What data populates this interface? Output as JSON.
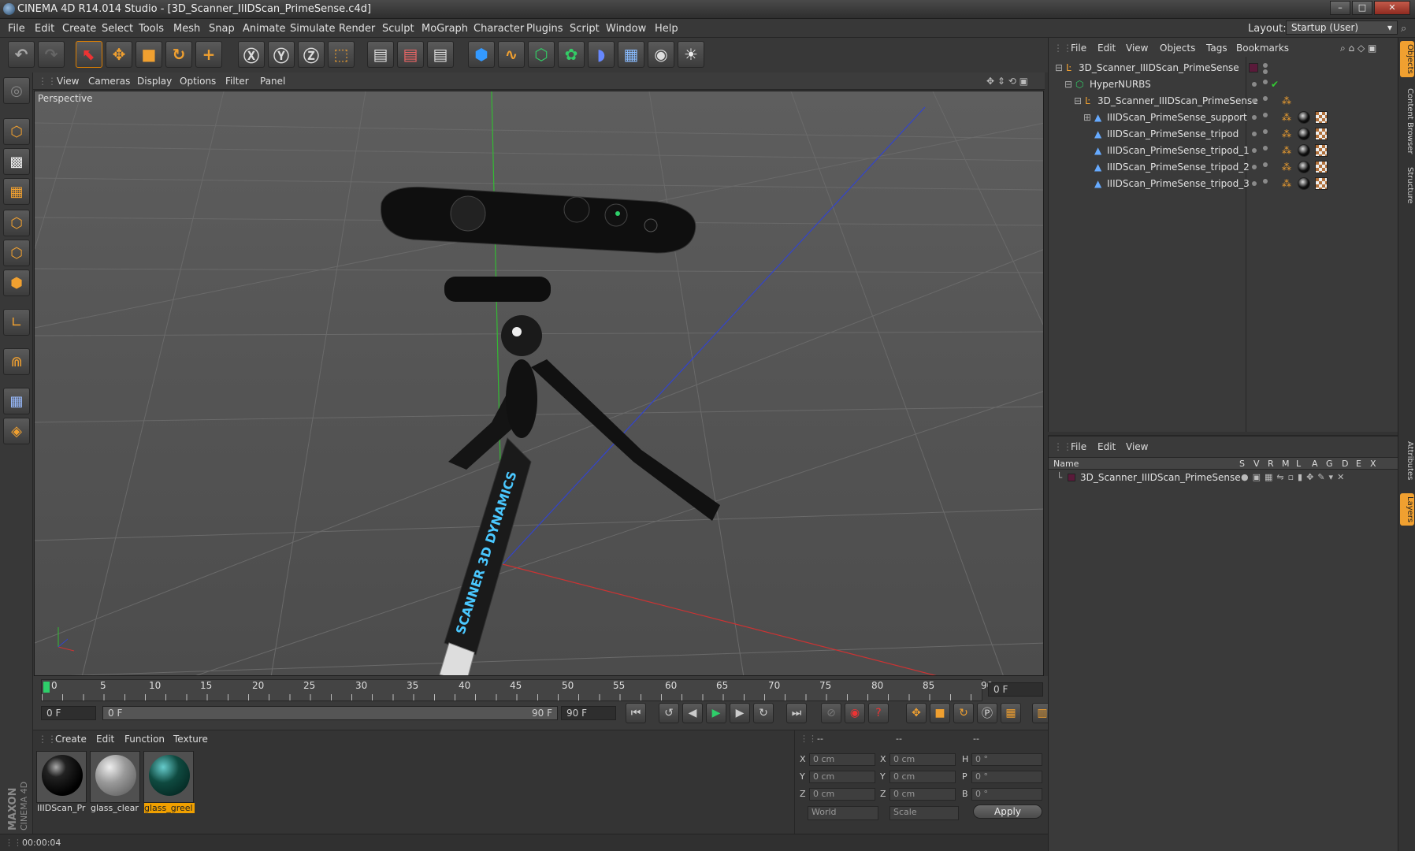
{
  "window": {
    "title": "CINEMA 4D R14.014 Studio - [3D_Scanner_IIIDScan_PrimeSense.c4d]",
    "min": "–",
    "max": "□",
    "close": "✕"
  },
  "menu": [
    "File",
    "Edit",
    "Create",
    "Select",
    "Tools",
    "Mesh",
    "Snap",
    "Animate",
    "Simulate",
    "Render",
    "Sculpt",
    "MoGraph",
    "Character",
    "Plugins",
    "Script",
    "Window",
    "Help"
  ],
  "layout": {
    "label": "Layout:",
    "value": "Startup (User)"
  },
  "toolbar": {
    "icons": [
      "undo-icon",
      "redo-icon",
      "select-icon",
      "move-icon",
      "scale-icon",
      "rotate-icon",
      "add-icon",
      "x-axis-icon",
      "y-axis-icon",
      "z-axis-icon",
      "coordinate-system-icon",
      "render-view-icon",
      "render-picture-queue-icon",
      "render-settings-icon",
      "cube-icon",
      "spline-icon",
      "nurbs-icon",
      "array-icon",
      "deformer-icon",
      "floor-icon",
      "camera-icon",
      "light-icon"
    ]
  },
  "left_tools": [
    "model-mode-icon",
    "texture-mode-icon",
    "workplane-icon",
    "point-mode-icon",
    "edge-mode-icon",
    "polygon-mode-icon",
    "axis-icon",
    "magnet-icon",
    "snap-icon",
    "locked-workplane-icon"
  ],
  "viewport": {
    "menu": [
      "View",
      "Cameras",
      "Display",
      "Options",
      "Filter",
      "Panel"
    ],
    "label": "Perspective",
    "brand_text": "SCANNER 3D DYNAMICS"
  },
  "timeline": {
    "ticks": [
      "0",
      "5",
      "10",
      "15",
      "20",
      "25",
      "30",
      "35",
      "40",
      "45",
      "50",
      "55",
      "60",
      "65",
      "70",
      "75",
      "80",
      "85",
      "90"
    ],
    "current": "0 F",
    "start": "0 F",
    "range_start": "0 F",
    "range_end": "90 F",
    "end": "90 F"
  },
  "materials": {
    "menu": [
      "Create",
      "Edit",
      "Function",
      "Texture"
    ],
    "items": [
      {
        "name": "IIIDScan_Pr",
        "color": "#111111"
      },
      {
        "name": "glass_clear",
        "color": "#9a9a9a"
      },
      {
        "name": "glass_greel",
        "color": "#0f4a40",
        "selected": true
      }
    ]
  },
  "coords": {
    "headers": [
      "--",
      "--",
      "--"
    ],
    "rows": [
      {
        "a": "X",
        "av": "0 cm",
        "b": "X",
        "bv": "0 cm",
        "c": "H",
        "cv": "0 °"
      },
      {
        "a": "Y",
        "av": "0 cm",
        "b": "Y",
        "bv": "0 cm",
        "c": "P",
        "cv": "0 °"
      },
      {
        "a": "Z",
        "av": "0 cm",
        "b": "Z",
        "bv": "0 cm",
        "c": "B",
        "cv": "0 °"
      }
    ],
    "mode1": "World",
    "mode2": "Scale",
    "apply": "Apply"
  },
  "status": {
    "time": "00:00:04"
  },
  "objects": {
    "menu": [
      "File",
      "Edit",
      "View",
      "Objects",
      "Tags",
      "Bookmarks"
    ],
    "tree": [
      {
        "name": "3D_Scanner_IIIDScan_PrimeSense",
        "icon": "null-icon"
      },
      {
        "name": "HyperNURBS",
        "icon": "hypernurbs-icon"
      },
      {
        "name": "3D_Scanner_IIIDScan_PrimeSense",
        "icon": "null-icon"
      },
      {
        "name": "IIIDScan_PrimeSense_support",
        "icon": "polygon-object-icon"
      },
      {
        "name": "IIIDScan_PrimeSense_tripod",
        "icon": "polygon-object-icon"
      },
      {
        "name": "IIIDScan_PrimeSense_tripod_1",
        "icon": "polygon-object-icon"
      },
      {
        "name": "IIIDScan_PrimeSense_tripod_2",
        "icon": "polygon-object-icon"
      },
      {
        "name": "IIIDScan_PrimeSense_tripod_3",
        "icon": "polygon-object-icon"
      }
    ]
  },
  "layers": {
    "menu": [
      "File",
      "Edit",
      "View"
    ],
    "columns": [
      "Name",
      "S",
      "V",
      "R",
      "M",
      "L",
      "A",
      "G",
      "D",
      "E",
      "X"
    ],
    "rows": [
      {
        "name": "3D_Scanner_IIIDScan_PrimeSense",
        "color": "#5a1a3a"
      }
    ]
  },
  "side_tabs": [
    "Objects",
    "Content Browser",
    "Structure",
    "Attributes",
    "Layers"
  ],
  "logo": {
    "line1": "MAXON",
    "line2": "CINEMA 4D"
  },
  "colors": {
    "accent": "#f0a030",
    "selected_material": "#f0a000",
    "x_axis": "#c03030",
    "y_axis": "#30b030",
    "z_axis": "#3040c0"
  }
}
